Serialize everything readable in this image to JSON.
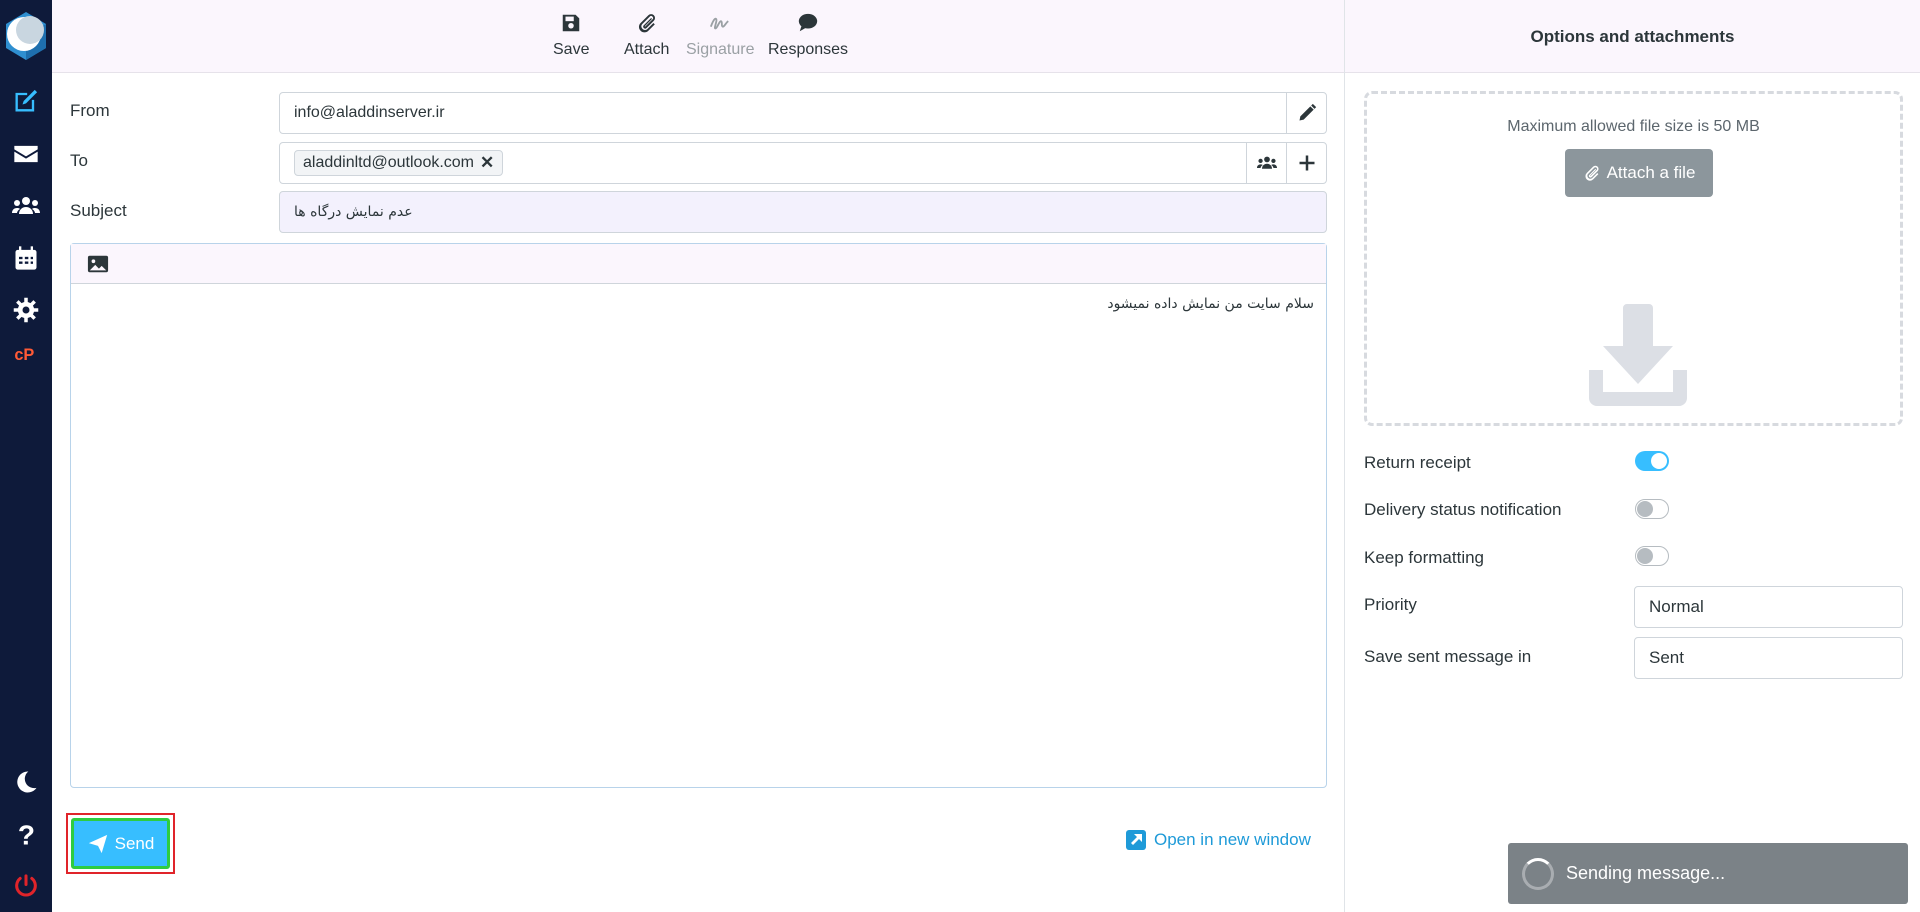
{
  "toolbar": {
    "save": "Save",
    "attach": "Attach",
    "signature": "Signature",
    "responses": "Responses"
  },
  "compose": {
    "from_label": "From",
    "from_value": "info@aladdinserver.ir",
    "to_label": "To",
    "to_recipient": "aladdinltd@outlook.com",
    "subject_label": "Subject",
    "subject_value": "عدم نمایش درگاه ها",
    "body": "سلام سایت من نمایش داده نمیشود"
  },
  "actions": {
    "send": "Send",
    "open_new_window": "Open in new window"
  },
  "options": {
    "title": "Options and attachments",
    "max_file_size": "Maximum allowed file size is 50 MB",
    "attach_file": "Attach a file",
    "return_receipt": {
      "label": "Return receipt",
      "on": true
    },
    "delivery_status": {
      "label": "Delivery status notification",
      "on": false
    },
    "keep_formatting": {
      "label": "Keep formatting",
      "on": false
    },
    "priority_label": "Priority",
    "priority_value": "Normal",
    "save_sent_label": "Save sent message in",
    "save_sent_value": "Sent"
  },
  "toast": {
    "message": "Sending message..."
  },
  "colors": {
    "sidebar": "#0e1a3a",
    "accent": "#37beff",
    "logout": "#e0242a"
  },
  "icons": [
    "logo-icon",
    "compose-icon",
    "mail-icon",
    "contacts-icon",
    "calendar-icon",
    "settings-icon",
    "cpanel-icon",
    "dark-mode-icon",
    "help-icon",
    "logout-icon"
  ]
}
